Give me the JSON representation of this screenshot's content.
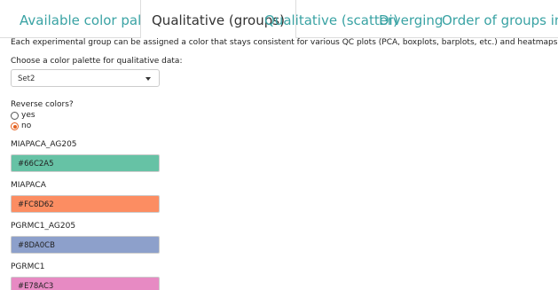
{
  "tabs": [
    {
      "label": "Available color palettes",
      "active": false
    },
    {
      "label": "Qualitative (groups)",
      "active": true
    },
    {
      "label": "Qualitative (scatter)",
      "active": false
    },
    {
      "label": "Diverging",
      "active": false
    },
    {
      "label": "Order of groups in plots",
      "active": false
    }
  ],
  "description": "Each experimental group can be assigned a color that stays consistent for various QC plots (PCA, boxplots, barplots, etc.) and heatmaps.",
  "palette_select": {
    "label": "Choose a color palette for qualitative data:",
    "value": "Set2"
  },
  "reverse": {
    "label": "Reverse colors?",
    "options": [
      {
        "label": "yes",
        "checked": false
      },
      {
        "label": "no",
        "checked": true
      }
    ]
  },
  "groups": [
    {
      "name": "MIAPACA_AG205",
      "color": "#66C2A5"
    },
    {
      "name": "MIAPACA",
      "color": "#FC8D62"
    },
    {
      "name": "PGRMC1_AG205",
      "color": "#8DA0CB"
    },
    {
      "name": "PGRMC1",
      "color": "#E78AC3"
    }
  ],
  "colors": {
    "tab_link": "#3aa3a4",
    "radio_accent": "#e4601f"
  }
}
